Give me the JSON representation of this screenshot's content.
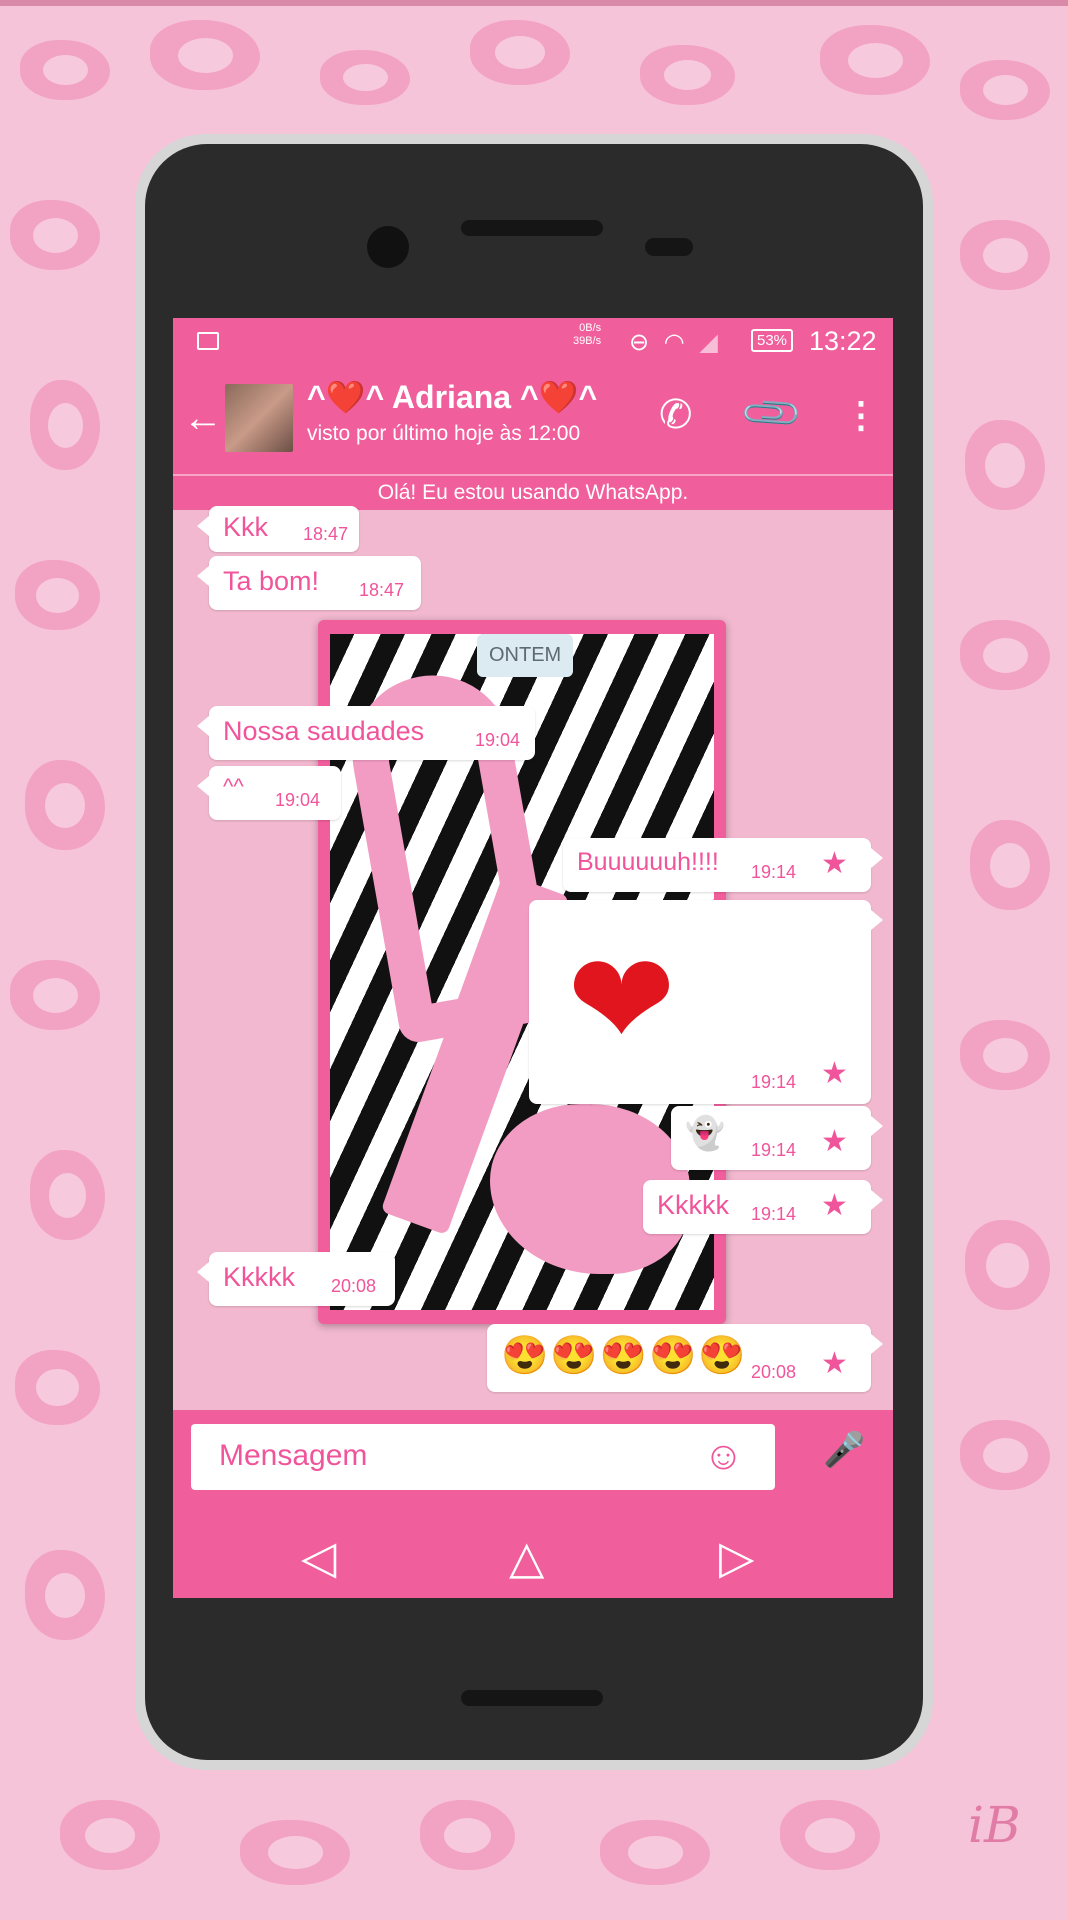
{
  "status_bar": {
    "net_down": "0B/s",
    "net_up": "39B/s",
    "battery": "53%",
    "time": "13:22"
  },
  "header": {
    "contact_name": "^❤️^ Adriana ^❤️^",
    "last_seen": "visto por último hoje às 12:00"
  },
  "status_line": "Olá! Eu estou usando WhatsApp.",
  "date_chip": "ONTEM",
  "messages": [
    {
      "direction": "in",
      "text": "Kkk",
      "time": "18:47"
    },
    {
      "direction": "in",
      "text": "Ta bom!",
      "time": "18:47"
    },
    {
      "direction": "in",
      "text": "Nossa saudades",
      "time": "19:04"
    },
    {
      "direction": "in",
      "text": "^^",
      "time": "19:04"
    },
    {
      "direction": "out",
      "text": "Buuuuuuh!!!!",
      "time": "19:14",
      "starred": true
    },
    {
      "direction": "out",
      "text": "❤",
      "time": "19:14",
      "starred": true
    },
    {
      "direction": "out",
      "text": "👻",
      "time": "19:14",
      "starred": true
    },
    {
      "direction": "out",
      "text": "Kkkkk",
      "time": "19:14",
      "starred": true
    },
    {
      "direction": "in",
      "text": "Kkkkk",
      "time": "20:08"
    },
    {
      "direction": "out",
      "text": "😍😍😍😍😍",
      "time": "20:08",
      "starred": true
    }
  ],
  "composer": {
    "placeholder": "Mensagem"
  },
  "icons": {
    "star": "★",
    "back": "←",
    "call": "✆",
    "clip": "📎",
    "more": "⋮",
    "emoji": "☺",
    "mic": "🎤",
    "nav_back": "◁",
    "nav_home": "△",
    "nav_recent": "▷"
  },
  "colors": {
    "accent": "#f15e9c",
    "bubble_text": "#f0549a",
    "background": "#f6c4d8"
  }
}
